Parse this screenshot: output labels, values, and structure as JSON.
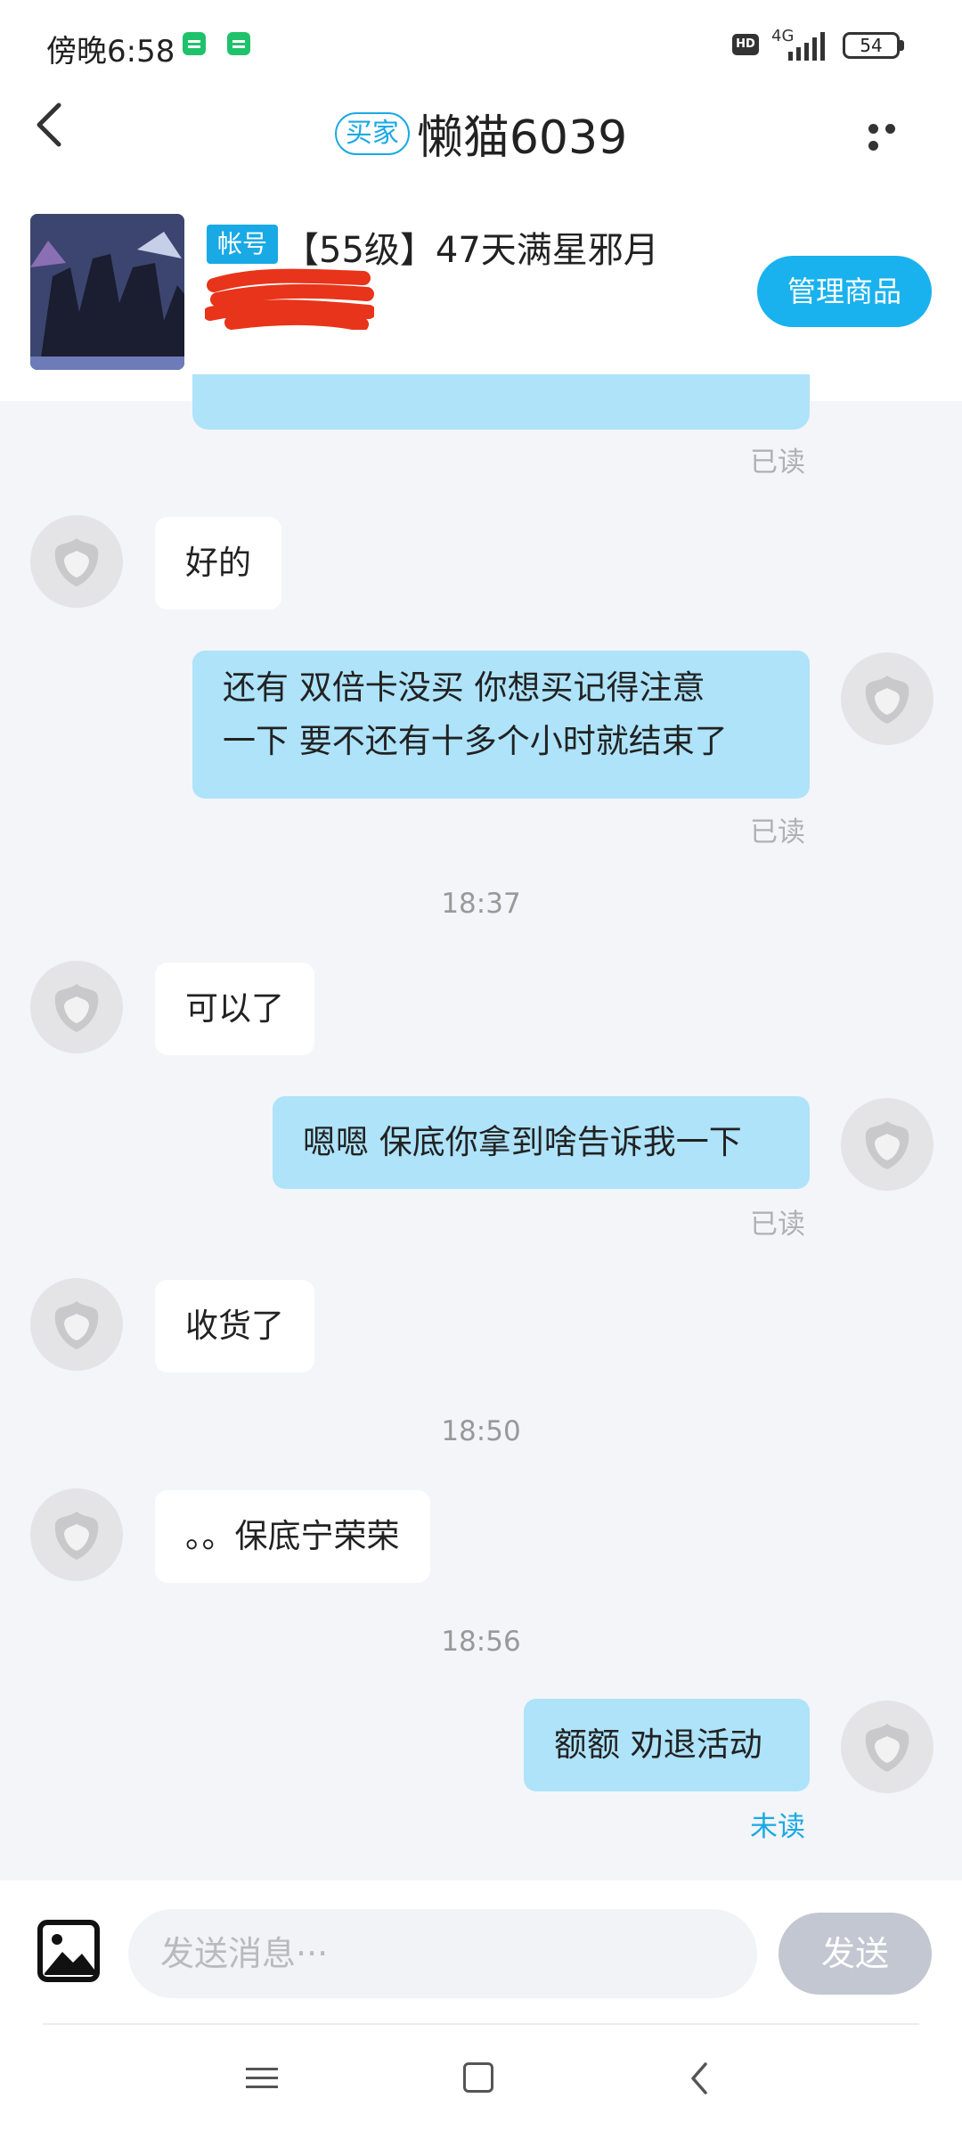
{
  "status_bar": {
    "time": "傍晚6:58",
    "hd_label": "HD",
    "network": "4G",
    "battery": "54",
    "colors": {
      "msg_icon": "#1fc26b"
    }
  },
  "header": {
    "buyer_tag": "买家",
    "title": "懒猫6039",
    "icons": {
      "back": "back-arrow-icon",
      "more": "more-dots-icon"
    }
  },
  "product": {
    "tag": "帐号",
    "title": "【55级】47天满星邪月",
    "manage_label": "管理商品"
  },
  "messages": [
    {
      "side": "out",
      "text": "",
      "status": "已读"
    },
    {
      "side": "in",
      "text": "好的"
    },
    {
      "side": "out",
      "lines": [
        "还有 双倍卡没买 你想买记得注意",
        "一下 要不还有十多个小时就结束了"
      ],
      "status": "已读"
    },
    {
      "time": "18:37"
    },
    {
      "side": "in",
      "text": "可以了"
    },
    {
      "side": "out",
      "text": "嗯嗯 保底你拿到啥告诉我一下",
      "status": "已读"
    },
    {
      "side": "in",
      "text": "收货了"
    },
    {
      "time": "18:50"
    },
    {
      "side": "in",
      "text": "。。保底宁荣荣"
    },
    {
      "time": "18:56"
    },
    {
      "side": "out",
      "text": "额额 劝退活动",
      "status": "未读"
    }
  ],
  "input": {
    "placeholder": "发送消息···",
    "send_label": "发送"
  },
  "colors": {
    "accent": "#19a9e5",
    "out_bubble": "#aee3fa",
    "in_bubble": "#ffffff",
    "chat_bg": "#f4f5f9",
    "send_disabled": "#c2c7d1"
  }
}
